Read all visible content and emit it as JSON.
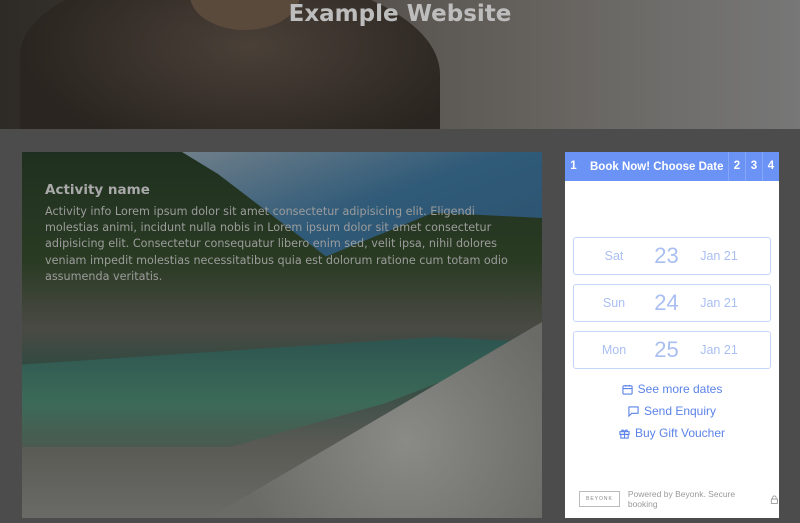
{
  "header": {
    "title": "Example Website"
  },
  "activity": {
    "name": "Activity name",
    "info": "Activity info Lorem ipsum dolor sit amet consectetur adipisicing elit. Eligendi molestias animi, incidunt nulla nobis in Lorem ipsum dolor sit amet consectetur adipisicing elit. Consectetur consequatur libero enim sed, velit ipsa, nihil dolores veniam impedit molestias necessitatibus quia est dolorum ratione cum totam odio assumenda veritatis."
  },
  "widget": {
    "steps": {
      "current_num": "1",
      "current_label": "Book Now! Choose Date",
      "others": [
        "2",
        "3",
        "4"
      ]
    },
    "dates": [
      {
        "day": "Sat",
        "num": "23",
        "month": "Jan 21"
      },
      {
        "day": "Sun",
        "num": "24",
        "month": "Jan 21"
      },
      {
        "day": "Mon",
        "num": "25",
        "month": "Jan 21"
      }
    ],
    "links": {
      "more_dates": "See more dates",
      "enquiry": "Send Enquiry",
      "voucher": "Buy Gift Voucher"
    },
    "footer": {
      "logo": "BEYONK",
      "text": "Powered by Beyonk. Secure booking"
    },
    "accent": "#6b93f5"
  }
}
